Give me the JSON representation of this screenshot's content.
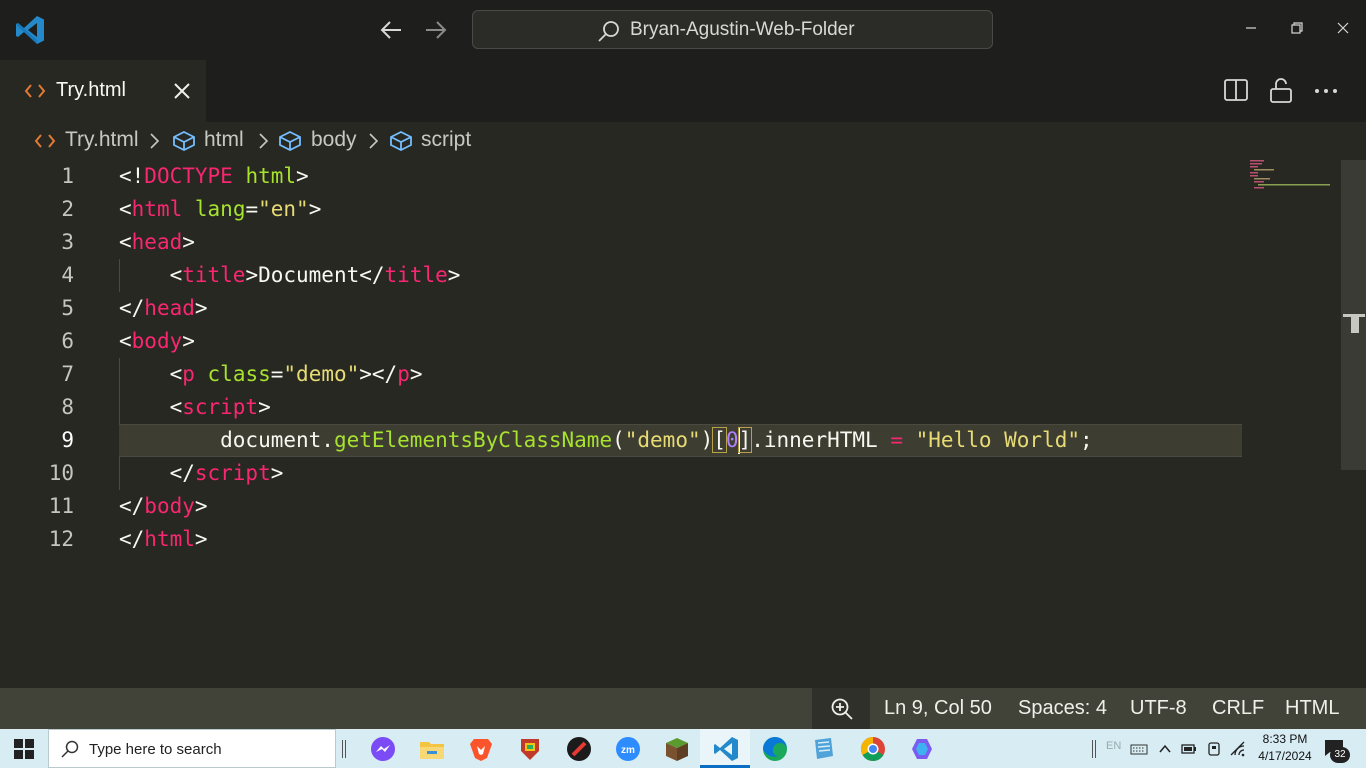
{
  "titlebar": {
    "search_text": "Bryan-Agustin-Web-Folder"
  },
  "tabs": [
    {
      "label": "Try.html",
      "active": true
    }
  ],
  "breadcrumb": [
    {
      "label": "Try.html",
      "icon": "html-file-icon"
    },
    {
      "label": "html",
      "icon": "symbol-cube-icon"
    },
    {
      "label": "body",
      "icon": "symbol-cube-icon"
    },
    {
      "label": "script",
      "icon": "symbol-cube-icon"
    }
  ],
  "editor": {
    "active_line": 9,
    "line_numbers": [
      "1",
      "2",
      "3",
      "4",
      "5",
      "6",
      "7",
      "8",
      "9",
      "10",
      "11",
      "12"
    ],
    "lines": [
      [
        {
          "t": "<!",
          "c": ""
        },
        {
          "t": "DOCTYPE",
          "c": "t-tag"
        },
        {
          "t": " ",
          "c": ""
        },
        {
          "t": "html",
          "c": "t-attr"
        },
        {
          "t": ">",
          "c": ""
        }
      ],
      [
        {
          "t": "<",
          "c": ""
        },
        {
          "t": "html",
          "c": "t-tag"
        },
        {
          "t": " ",
          "c": ""
        },
        {
          "t": "lang",
          "c": "t-attr"
        },
        {
          "t": "=",
          "c": ""
        },
        {
          "t": "\"en\"",
          "c": "t-str"
        },
        {
          "t": ">",
          "c": ""
        }
      ],
      [
        {
          "t": "<",
          "c": ""
        },
        {
          "t": "head",
          "c": "t-tag"
        },
        {
          "t": ">",
          "c": ""
        }
      ],
      [
        {
          "t": "    <",
          "c": ""
        },
        {
          "t": "title",
          "c": "t-tag"
        },
        {
          "t": ">Document</",
          "c": ""
        },
        {
          "t": "title",
          "c": "t-tag"
        },
        {
          "t": ">",
          "c": ""
        }
      ],
      [
        {
          "t": "</",
          "c": ""
        },
        {
          "t": "head",
          "c": "t-tag"
        },
        {
          "t": ">",
          "c": ""
        }
      ],
      [
        {
          "t": "<",
          "c": ""
        },
        {
          "t": "body",
          "c": "t-tag"
        },
        {
          "t": ">",
          "c": ""
        }
      ],
      [
        {
          "t": "    <",
          "c": ""
        },
        {
          "t": "p",
          "c": "t-tag"
        },
        {
          "t": " ",
          "c": ""
        },
        {
          "t": "class",
          "c": "t-attr"
        },
        {
          "t": "=",
          "c": ""
        },
        {
          "t": "\"demo\"",
          "c": "t-str"
        },
        {
          "t": "></",
          "c": ""
        },
        {
          "t": "p",
          "c": "t-tag"
        },
        {
          "t": ">",
          "c": ""
        }
      ],
      [
        {
          "t": "    <",
          "c": ""
        },
        {
          "t": "script",
          "c": "t-tag"
        },
        {
          "t": ">",
          "c": ""
        }
      ],
      [
        {
          "t": "        document.",
          "c": ""
        },
        {
          "t": "getElementsByClassName",
          "c": "t-fn"
        },
        {
          "t": "(",
          "c": ""
        },
        {
          "t": "\"demo\"",
          "c": "t-str"
        },
        {
          "t": ")",
          "c": ""
        },
        {
          "t": "[",
          "c": "t-br"
        },
        {
          "t": "0",
          "c": "t-num"
        },
        {
          "t": "|",
          "c": "caret"
        },
        {
          "t": "]",
          "c": "t-br"
        },
        {
          "t": ".innerHTML ",
          "c": ""
        },
        {
          "t": "=",
          "c": "t-op"
        },
        {
          "t": " ",
          "c": ""
        },
        {
          "t": "\"Hello World\"",
          "c": "t-str"
        },
        {
          "t": ";",
          "c": ""
        }
      ],
      [
        {
          "t": "    </",
          "c": ""
        },
        {
          "t": "script",
          "c": "t-tag"
        },
        {
          "t": ">",
          "c": ""
        }
      ],
      [
        {
          "t": "</",
          "c": ""
        },
        {
          "t": "body",
          "c": "t-tag"
        },
        {
          "t": ">",
          "c": ""
        }
      ],
      [
        {
          "t": "</",
          "c": ""
        },
        {
          "t": "html",
          "c": "t-tag"
        },
        {
          "t": ">",
          "c": ""
        }
      ]
    ]
  },
  "statusbar": {
    "position": "Ln 9, Col 50",
    "indent": "Spaces: 4",
    "encoding": "UTF-8",
    "eol": "CRLF",
    "language": "HTML"
  },
  "taskbar": {
    "search_placeholder": "Type here to search",
    "apps": [
      "messenger-icon",
      "file-explorer-icon",
      "brave-icon",
      "app-shield-icon",
      "app-red-icon",
      "zoom-icon",
      "minecraft-icon",
      "vscode-icon",
      "edge-icon",
      "notepad-icon",
      "chrome-icon",
      "copilot-icon"
    ],
    "active_app": "vscode-icon",
    "tray_lang": "EN",
    "time": "8:33 PM",
    "date": "4/17/2024",
    "notification_count": "32"
  },
  "colors": {
    "editor_bg": "#272822",
    "titlebar_bg": "#1e1f1c",
    "statusbar_bg": "#414339",
    "tag": "#f92672",
    "attr": "#a6e22e",
    "string": "#e6db74",
    "number": "#ae81ff",
    "taskbar_bg": "#d7ecf3"
  }
}
